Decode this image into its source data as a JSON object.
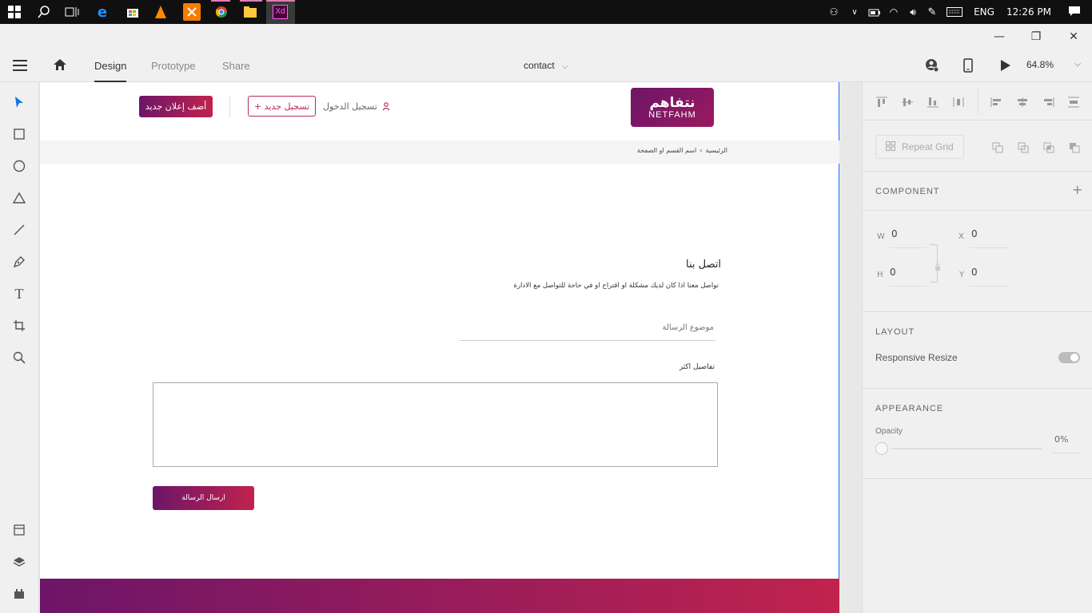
{
  "taskbar": {
    "icons": [
      "windows-start-icon",
      "search-icon",
      "task-view-icon",
      "edge-icon",
      "store-icon",
      "vlc-icon",
      "xampp-icon",
      "chrome-icon",
      "file-explorer-icon",
      "xd-icon"
    ],
    "xd_label": "Xd",
    "lang": "ENG",
    "time": "12:26 PM"
  },
  "window": {
    "minimize": "—",
    "restore": "❐",
    "close": "✕"
  },
  "menubar": {
    "tab_design": "Design",
    "tab_prototype": "Prototype",
    "tab_share": "Share",
    "doc_title": "contact",
    "zoom": "64.8%"
  },
  "artboard": {
    "add_ad_button": "أضف إعلان جديد",
    "register_button": "+ تسجيل جديد",
    "login_text": "تسجيل الدخول",
    "logo_arabic": "نتفاهم",
    "logo_latin": "NETFAHM",
    "breadcrumb_home": "الرئيسية",
    "breadcrumb_sep": "›",
    "breadcrumb_current": "اسم القسم او الصفحة",
    "contact_title": "اتصل بنا",
    "contact_subtitle": "تواصل معنا اذا كان لديك مشكلة او اقتراح او في حاجة للتواصل مع الادارة",
    "subject_placeholder": "موضوع الرسالة",
    "details_label": "تفاصيل اكثر",
    "send_button": "ارسال الرسالة"
  },
  "panel": {
    "repeat_grid": "Repeat Grid",
    "component_label": "COMPONENT",
    "w_label": "W",
    "w_value": "0",
    "x_label": "X",
    "x_value": "0",
    "h_label": "H",
    "h_value": "0",
    "y_label": "Y",
    "y_value": "0",
    "layout_label": "LAYOUT",
    "responsive_resize": "Responsive Resize",
    "appearance_label": "APPEARANCE",
    "opacity_label": "Opacity",
    "opacity_value": "0%"
  },
  "colors": {
    "brand_start": "#6d1568",
    "brand_end": "#c0234e",
    "selection_blue": "#1a73e8"
  }
}
